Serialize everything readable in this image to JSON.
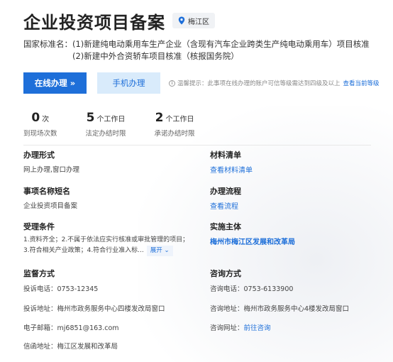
{
  "header": {
    "title": "企业投资项目备案",
    "region": "梅江区"
  },
  "standard_name": {
    "label": "国家标准名：",
    "lines": [
      "(1)新建纯电动乘用车生产企业（含现有汽车企业跨类生产纯电动乘用车）项目核准",
      "(2)新建中外合资轿车项目核准（核报国务院）"
    ]
  },
  "actions": {
    "online_label": "在线办理 »",
    "mobile_label": "手机办理",
    "tip_text": "温馨提示：此事项在线办理的账户可信等级需达到四级及以上",
    "tip_link": "查看当前等级"
  },
  "stats": [
    {
      "num": "0",
      "unit": "次",
      "label": "到现场次数"
    },
    {
      "num": "5",
      "unit": "个工作日",
      "label": "法定办结时限"
    },
    {
      "num": "2",
      "unit": "个工作日",
      "label": "承诺办结时限"
    }
  ],
  "details": {
    "mode_title": "办理形式",
    "mode_value": "网上办理,窗口办理",
    "materials_title": "材料清单",
    "materials_link": "查看材料清单",
    "short_name_title": "事项名称短名",
    "short_name_value": "企业投资项目备案",
    "process_title": "办理流程",
    "process_link": "查看流程",
    "conditions_title": "受理条件",
    "conditions_text": "1.资料齐全；2.不属于依法应实行核准或审批管理的项目；3.符合相关产业政策；4.符合行业准入标...",
    "expand_label": "展开 ⌄",
    "agency_title": "实施主体",
    "agency_link": "梅州市梅江区发展和改革局"
  },
  "supervision": {
    "title": "监督方式",
    "phone_label": "投诉电话：",
    "phone_value": "0753-12345",
    "address_label": "投诉地址：",
    "address_value": "梅州市政务服务中心四楼发改局窗口",
    "email_label": "电子邮箱：",
    "email_value": "mj6851@163.com",
    "letter_label": "信函地址：",
    "letter_value": "梅江区发展和改革局"
  },
  "consult": {
    "title": "咨询方式",
    "phone_label": "咨询电话：",
    "phone_value": "0753-6133900",
    "address_label": "咨询地址：",
    "address_value": "梅州市政务服务中心4楼发改局窗口",
    "web_label": "咨询网址：",
    "web_link": "前往咨询"
  }
}
